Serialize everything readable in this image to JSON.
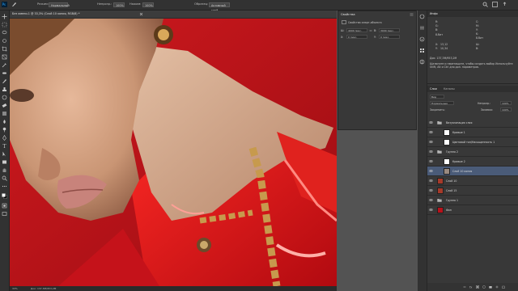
{
  "toolbar_options": {
    "mode_label": "Режим:",
    "mode_value": "Нормальный",
    "opacity_label": "Непрозр.:",
    "opacity_value": "100%",
    "flow_label": "Нажим:",
    "flow_value": "100%",
    "sample_label": "Образец:",
    "sample_value": "Активный слой"
  },
  "document": {
    "tab_title": "Без имени-1 @ 33,3% (Слой 10 копия, RGB/8) *"
  },
  "properties": {
    "title": "Свойства",
    "subtitle": "Свойства смарт-объекта",
    "w_label": "Ш:",
    "w_value": "4000 пикс.",
    "h_label": "В:",
    "h_value": "3000 пикс.",
    "x_label": "X:",
    "x_value": "0 пикс.",
    "y_label": "Y:",
    "y_value": "0 пикс."
  },
  "info": {
    "title": "Инфо",
    "r_label": "R:",
    "g_label": "G:",
    "b_label": "B:",
    "c_label": "C:",
    "m_label": "M:",
    "y_label": "Y:",
    "k_label": "K:",
    "bit_left": "8-бит",
    "bit_right": "8-бит",
    "x_label": "X:",
    "y2_label": "Y:",
    "x_value": "13,12",
    "y_value": "10,34",
    "w_label": "Ш:",
    "h_label": "В:",
    "doc_label": "Док: 137,3М/953,2М",
    "hint": "Щелкните и перетащите, чтобы создать выбор Используйте Shift, Alt и Ctrl для доп. параметров."
  },
  "layers_panel": {
    "tab_layers": "Слои",
    "tab_channels": "Каналы",
    "kind_value": "Вид",
    "blend_value": "Нормальные",
    "opacity_label": "Непрозр.:",
    "opacity_value": "100%",
    "lock_label": "Закрепить:",
    "fill_label": "Заливка:",
    "fill_value": "100%",
    "layers": [
      {
        "name": "Визуализация слоя",
        "type": "group"
      },
      {
        "name": "Кривые 1",
        "type": "adjustment"
      },
      {
        "name": "Цветовой тон/Насыщенность 1",
        "type": "adjustment"
      },
      {
        "name": "Группа 2",
        "type": "group"
      },
      {
        "name": "Кривые 2",
        "type": "adjustment"
      },
      {
        "name": "Слой 10 копия",
        "type": "pixel"
      },
      {
        "name": "Слой 10",
        "type": "pixel"
      },
      {
        "name": "Слой 15",
        "type": "pixel"
      },
      {
        "name": "Группа 1",
        "type": "group"
      },
      {
        "name": "Фон",
        "type": "pixel"
      }
    ]
  },
  "status": {
    "zoom": "33%",
    "doc": "Док: 137,3М/953,2М"
  },
  "colors": {
    "accent": "#4a5b78",
    "panel": "#383838",
    "dark": "#323232"
  }
}
